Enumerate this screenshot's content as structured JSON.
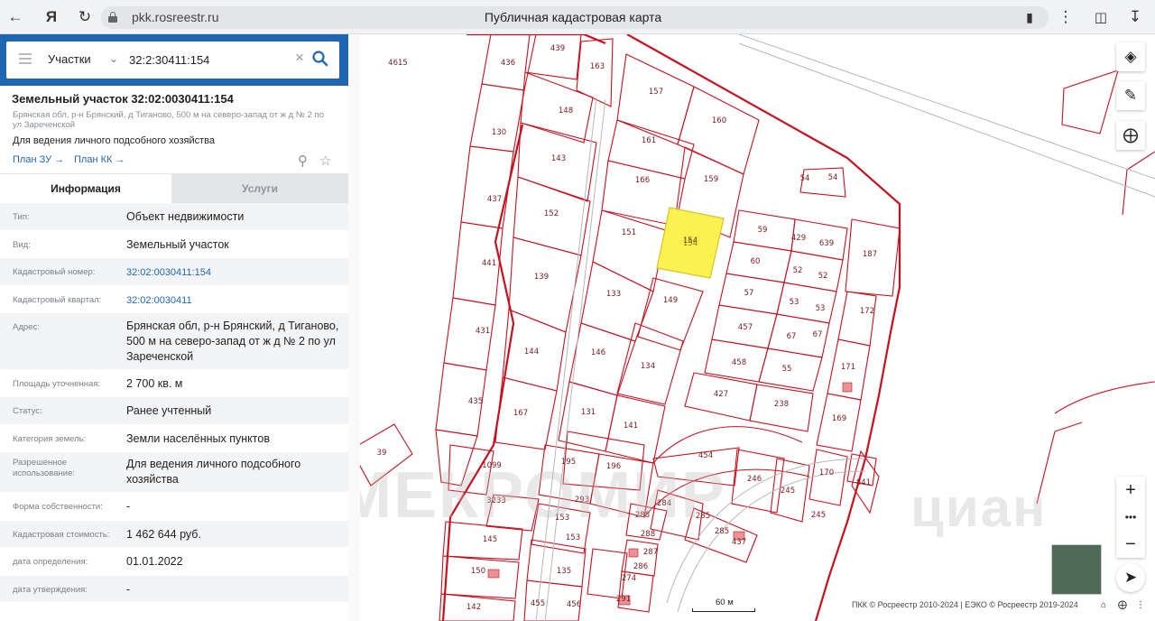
{
  "browser": {
    "url": "pkk.rosreestr.ru",
    "page_title": "Публичная кадастровая карта"
  },
  "search": {
    "type_label": "Участки",
    "query": "32:2:30411:154"
  },
  "object": {
    "title": "Земельный участок 32:02:0030411:154",
    "address": "Брянская обл, р-н Брянский, д Тиганово, 500 м на северо-запад от ж д № 2 по ул Зареченской",
    "purpose": "Для ведения личного подсобного хозяйства",
    "plan_zu": "План ЗУ →",
    "plan_kk": "План КК →"
  },
  "tabs": {
    "info": "Информация",
    "services": "Услуги"
  },
  "fields": [
    {
      "label": "Тип:",
      "value": "Объект недвижимости"
    },
    {
      "label": "Вид:",
      "value": "Земельный участок"
    },
    {
      "label": "Кадастровый номер:",
      "value": "32:02:0030411:154"
    },
    {
      "label": "Кадастровый квартал:",
      "value": "32:02:0030411"
    },
    {
      "label": "Адрес:",
      "value": "Брянская обл, р-н Брянский, д Тиганово, 500 м на северо-запад от ж д № 2 по ул Зареченской"
    },
    {
      "label": "Площадь уточненная:",
      "value": "2 700 кв. м"
    },
    {
      "label": "Статус:",
      "value": "Ранее учтенный"
    },
    {
      "label": "Категория земель:",
      "value": "Земли населённых пунктов"
    },
    {
      "label": "Разрешенное использование:",
      "value": "Для ведения личного подсобного хозяйства"
    },
    {
      "label": "Форма собственности:",
      "value": "-"
    },
    {
      "label": "Кадастровая стоимость:",
      "value": "1 462 644 руб."
    },
    {
      "label": "дата определения:",
      "value": "01.01.2022"
    },
    {
      "label": "дата утверждения:",
      "value": "-"
    }
  ],
  "map": {
    "scale_label": "60 м",
    "attribution": "ПКК © Росреестр 2010-2024 | ЕЭКО © Росреестр 2019-2024",
    "watermark_left": "МЕКРОМИР",
    "watermark_right": "циан",
    "selected_parcel": "154",
    "parcel_labels": [
      "4615",
      "439",
      "436",
      "163",
      "157",
      "160",
      "148",
      "130",
      "143",
      "161",
      "166",
      "159",
      "437",
      "152",
      "151",
      "154",
      "59",
      "429",
      "639",
      "187",
      "54",
      "54",
      "441",
      "139",
      "133",
      "149",
      "60",
      "52",
      "52",
      "57",
      "53",
      "53",
      "172",
      "431",
      "457",
      "67",
      "67",
      "144",
      "146",
      "134",
      "458",
      "55",
      "171",
      "435",
      "427",
      "238",
      "167",
      "131",
      "141",
      "169",
      "454",
      "39",
      "1099",
      "195",
      "196",
      "246",
      "245",
      "170",
      "841",
      "3233",
      "293",
      "284",
      "288",
      "285",
      "285",
      "437",
      "245",
      "153",
      "288",
      "145",
      "153",
      "287",
      "286",
      "150",
      "135",
      "274",
      "291",
      "142",
      "455",
      "456"
    ]
  },
  "colors": {
    "header_blue": "#1f66b2",
    "parcel_red": "#c8101e",
    "selected_fill": "#fbf24f"
  }
}
